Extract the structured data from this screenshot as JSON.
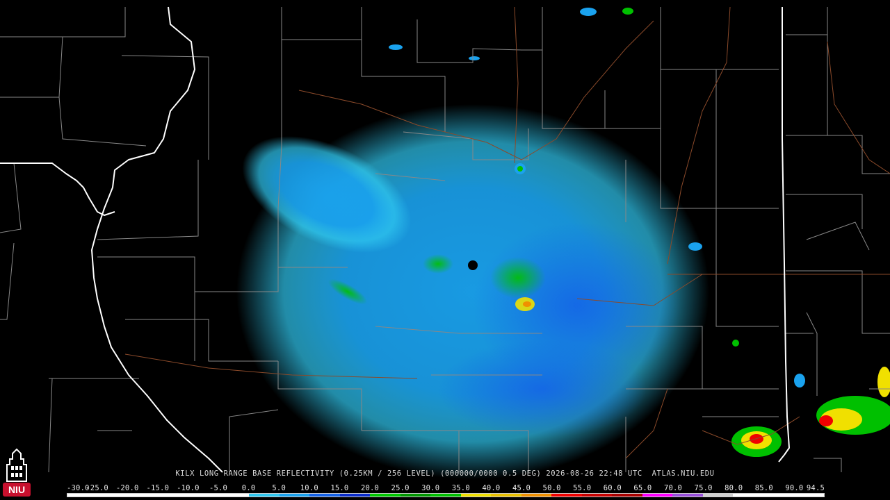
{
  "title": "KILX LONG RANGE BASE REFLECTIVITY (0.25KM / 256 LEVEL) (000000/0000 0.5 DEG) 2026-08-26 22:48 UTC  ATLAS.NIU.EDU",
  "colorbar": {
    "ticks": [
      "-30.0",
      "-25.0",
      "-20.0",
      "-15.0",
      "-10.0",
      "-5.0",
      "0.0",
      "5.0",
      "10.0",
      "15.0",
      "20.0",
      "25.0",
      "30.0",
      "35.0",
      "40.0",
      "45.0",
      "50.0",
      "55.0",
      "60.0",
      "65.0",
      "70.0",
      "75.0",
      "80.0",
      "85.0",
      "90.0",
      "94.5"
    ],
    "colors": [
      "#ffffff",
      "#ffffff",
      "#ffffff",
      "#ffffff",
      "#ffffff",
      "#ffffff",
      "#30c8f0",
      "#1aa2ee",
      "#1462e8",
      "#0a2ccc",
      "#00c800",
      "#009600",
      "#00c000",
      "#f0e000",
      "#e8c000",
      "#f09000",
      "#f00000",
      "#c80000",
      "#a80000",
      "#ff00ff",
      "#9a50dc",
      "#d0d0d0",
      "#ffffff",
      "#ffffff",
      "#ffffff"
    ]
  },
  "logo": {
    "label": "NIU",
    "color": "#c8102e"
  }
}
